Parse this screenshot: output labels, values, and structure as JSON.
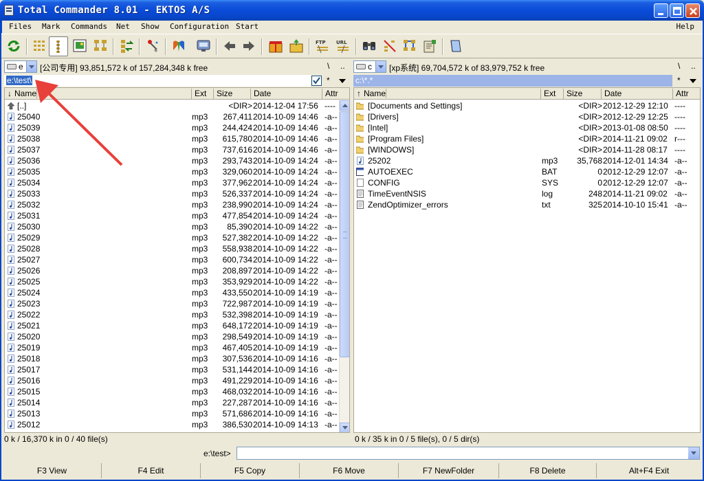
{
  "window": {
    "title": "Total Commander 8.01 - EKTOS A/S"
  },
  "menu": {
    "items": [
      "Files",
      "Mark",
      "Commands",
      "Net",
      "Show",
      "Configuration",
      "Start"
    ],
    "help": "Help"
  },
  "toolbar": {
    "icons": [
      "refresh-icon",
      "brief-view-icon",
      "full-view-icon",
      "thumbnails-icon",
      "tree-icon",
      "compare-icon",
      "multi-rename-icon",
      "internet-icon",
      "ftp-connect-icon",
      "back-icon",
      "forward-icon",
      "pack-icon",
      "unpack-icon",
      "ftp-icon",
      "url-icon",
      "find-icon",
      "sync-icon",
      "tools-icon",
      "notepad-icon",
      "help-book-icon"
    ]
  },
  "left": {
    "drive_letter": "e",
    "drive_info": "[公司专用]  93,851,572 k of 157,284,348 k free",
    "root_btn": "\\",
    "up_btn": "..",
    "path": "e:\\test\\",
    "star": "*",
    "columns": {
      "name": "Name",
      "ext": "Ext",
      "size": "Size",
      "date": "Date",
      "attr": "Attr"
    },
    "files": [
      {
        "name": "[..]",
        "ext": "",
        "size": "<DIR>",
        "date": "2014-12-04 17:56",
        "attr": "----"
      },
      {
        "name": "25040",
        "ext": "mp3",
        "size": "267,411",
        "date": "2014-10-09 14:46",
        "attr": "-a--"
      },
      {
        "name": "25039",
        "ext": "mp3",
        "size": "244,424",
        "date": "2014-10-09 14:46",
        "attr": "-a--"
      },
      {
        "name": "25038",
        "ext": "mp3",
        "size": "615,780",
        "date": "2014-10-09 14:46",
        "attr": "-a--"
      },
      {
        "name": "25037",
        "ext": "mp3",
        "size": "737,616",
        "date": "2014-10-09 14:46",
        "attr": "-a--"
      },
      {
        "name": "25036",
        "ext": "mp3",
        "size": "293,743",
        "date": "2014-10-09 14:24",
        "attr": "-a--"
      },
      {
        "name": "25035",
        "ext": "mp3",
        "size": "329,060",
        "date": "2014-10-09 14:24",
        "attr": "-a--"
      },
      {
        "name": "25034",
        "ext": "mp3",
        "size": "377,962",
        "date": "2014-10-09 14:24",
        "attr": "-a--"
      },
      {
        "name": "25033",
        "ext": "mp3",
        "size": "526,337",
        "date": "2014-10-09 14:24",
        "attr": "-a--"
      },
      {
        "name": "25032",
        "ext": "mp3",
        "size": "238,990",
        "date": "2014-10-09 14:24",
        "attr": "-a--"
      },
      {
        "name": "25031",
        "ext": "mp3",
        "size": "477,854",
        "date": "2014-10-09 14:24",
        "attr": "-a--"
      },
      {
        "name": "25030",
        "ext": "mp3",
        "size": "85,390",
        "date": "2014-10-09 14:22",
        "attr": "-a--"
      },
      {
        "name": "25029",
        "ext": "mp3",
        "size": "527,382",
        "date": "2014-10-09 14:22",
        "attr": "-a--"
      },
      {
        "name": "25028",
        "ext": "mp3",
        "size": "558,938",
        "date": "2014-10-09 14:22",
        "attr": "-a--"
      },
      {
        "name": "25027",
        "ext": "mp3",
        "size": "600,734",
        "date": "2014-10-09 14:22",
        "attr": "-a--"
      },
      {
        "name": "25026",
        "ext": "mp3",
        "size": "208,897",
        "date": "2014-10-09 14:22",
        "attr": "-a--"
      },
      {
        "name": "25025",
        "ext": "mp3",
        "size": "353,929",
        "date": "2014-10-09 14:22",
        "attr": "-a--"
      },
      {
        "name": "25024",
        "ext": "mp3",
        "size": "433,550",
        "date": "2014-10-09 14:19",
        "attr": "-a--"
      },
      {
        "name": "25023",
        "ext": "mp3",
        "size": "722,987",
        "date": "2014-10-09 14:19",
        "attr": "-a--"
      },
      {
        "name": "25022",
        "ext": "mp3",
        "size": "532,398",
        "date": "2014-10-09 14:19",
        "attr": "-a--"
      },
      {
        "name": "25021",
        "ext": "mp3",
        "size": "648,172",
        "date": "2014-10-09 14:19",
        "attr": "-a--"
      },
      {
        "name": "25020",
        "ext": "mp3",
        "size": "298,549",
        "date": "2014-10-09 14:19",
        "attr": "-a--"
      },
      {
        "name": "25019",
        "ext": "mp3",
        "size": "467,405",
        "date": "2014-10-09 14:19",
        "attr": "-a--"
      },
      {
        "name": "25018",
        "ext": "mp3",
        "size": "307,536",
        "date": "2014-10-09 14:16",
        "attr": "-a--"
      },
      {
        "name": "25017",
        "ext": "mp3",
        "size": "531,144",
        "date": "2014-10-09 14:16",
        "attr": "-a--"
      },
      {
        "name": "25016",
        "ext": "mp3",
        "size": "491,229",
        "date": "2014-10-09 14:16",
        "attr": "-a--"
      },
      {
        "name": "25015",
        "ext": "mp3",
        "size": "468,032",
        "date": "2014-10-09 14:16",
        "attr": "-a--"
      },
      {
        "name": "25014",
        "ext": "mp3",
        "size": "227,287",
        "date": "2014-10-09 14:16",
        "attr": "-a--"
      },
      {
        "name": "25013",
        "ext": "mp3",
        "size": "571,686",
        "date": "2014-10-09 14:16",
        "attr": "-a--"
      },
      {
        "name": "25012",
        "ext": "mp3",
        "size": "386,530",
        "date": "2014-10-09 14:13",
        "attr": "-a--"
      }
    ],
    "status": "0 k / 16,370 k in 0 / 40 file(s)"
  },
  "right": {
    "drive_letter": "c",
    "drive_info": "[xp系统]  69,704,572 k of 83,979,752 k free",
    "root_btn": "\\",
    "up_btn": "..",
    "path": "c:\\*.*",
    "star": "*",
    "columns": {
      "name": "Name",
      "ext": "Ext",
      "size": "Size",
      "date": "Date",
      "attr": "Attr"
    },
    "files": [
      {
        "name": "[Documents and Settings]",
        "ext": "",
        "size": "<DIR>",
        "date": "2012-12-29 12:10",
        "attr": "----",
        "icon": "folder"
      },
      {
        "name": "[Drivers]",
        "ext": "",
        "size": "<DIR>",
        "date": "2012-12-29 12:25",
        "attr": "----",
        "icon": "folder"
      },
      {
        "name": "[Intel]",
        "ext": "",
        "size": "<DIR>",
        "date": "2013-01-08 08:50",
        "attr": "----",
        "icon": "folder"
      },
      {
        "name": "[Program Files]",
        "ext": "",
        "size": "<DIR>",
        "date": "2014-11-21 09:02",
        "attr": "r---",
        "icon": "folder"
      },
      {
        "name": "[WINDOWS]",
        "ext": "",
        "size": "<DIR>",
        "date": "2014-11-28 08:17",
        "attr": "----",
        "icon": "folder"
      },
      {
        "name": "25202",
        "ext": "mp3",
        "size": "35,768",
        "date": "2014-12-01 14:34",
        "attr": "-a--",
        "icon": "audio"
      },
      {
        "name": "AUTOEXEC",
        "ext": "BAT",
        "size": "0",
        "date": "2012-12-29 12:07",
        "attr": "-a--",
        "icon": "bat"
      },
      {
        "name": "CONFIG",
        "ext": "SYS",
        "size": "0",
        "date": "2012-12-29 12:07",
        "attr": "-a--",
        "icon": "sys"
      },
      {
        "name": "TimeEventNSIS",
        "ext": "log",
        "size": "248",
        "date": "2014-11-21 09:02",
        "attr": "-a--",
        "icon": "text"
      },
      {
        "name": "ZendOptimizer_errors",
        "ext": "txt",
        "size": "325",
        "date": "2014-10-10 15:41",
        "attr": "-a--",
        "icon": "text"
      }
    ],
    "status": "0 k / 35 k in 0 / 5 file(s), 0 / 5 dir(s)"
  },
  "cmdline": {
    "label": "e:\\test>",
    "value": ""
  },
  "fkeys": [
    "F3 View",
    "F4 Edit",
    "F5 Copy",
    "F6 Move",
    "F7 NewFolder",
    "F8 Delete",
    "Alt+F4 Exit"
  ],
  "colors": {
    "title_bar": "#0a4bd8",
    "path_selection": "#316ac5",
    "inactive_path": "#9cb4e8",
    "annotation_arrow": "#e8403a"
  }
}
